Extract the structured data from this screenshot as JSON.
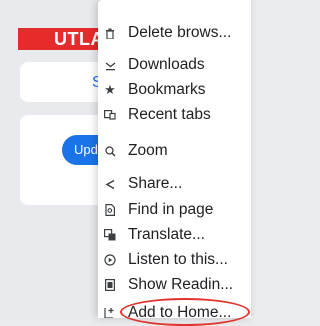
{
  "background": {
    "tab_text": "UTLA",
    "card1_text": "S",
    "button_text": "Upd"
  },
  "menu": {
    "items": [
      {
        "label": "Delete brows...",
        "icon": "trash-icon"
      },
      {
        "label": "Downloads",
        "icon": "download-icon"
      },
      {
        "label": "Bookmarks",
        "icon": "star-icon"
      },
      {
        "label": "Recent tabs",
        "icon": "recent-tabs-icon"
      },
      {
        "label": "Zoom",
        "icon": "zoom-icon"
      },
      {
        "label": "Share...",
        "icon": "share-icon"
      },
      {
        "label": "Find in page",
        "icon": "find-icon"
      },
      {
        "label": "Translate...",
        "icon": "translate-icon"
      },
      {
        "label": "Listen to this...",
        "icon": "play-icon"
      },
      {
        "label": "Show Readin...",
        "icon": "reader-icon"
      },
      {
        "label": "Add to Home...",
        "icon": "add-home-icon"
      }
    ]
  },
  "colors": {
    "accent": "#1a73e8",
    "brand_red": "#e52b2b",
    "highlight_circle": "#e0342f"
  }
}
